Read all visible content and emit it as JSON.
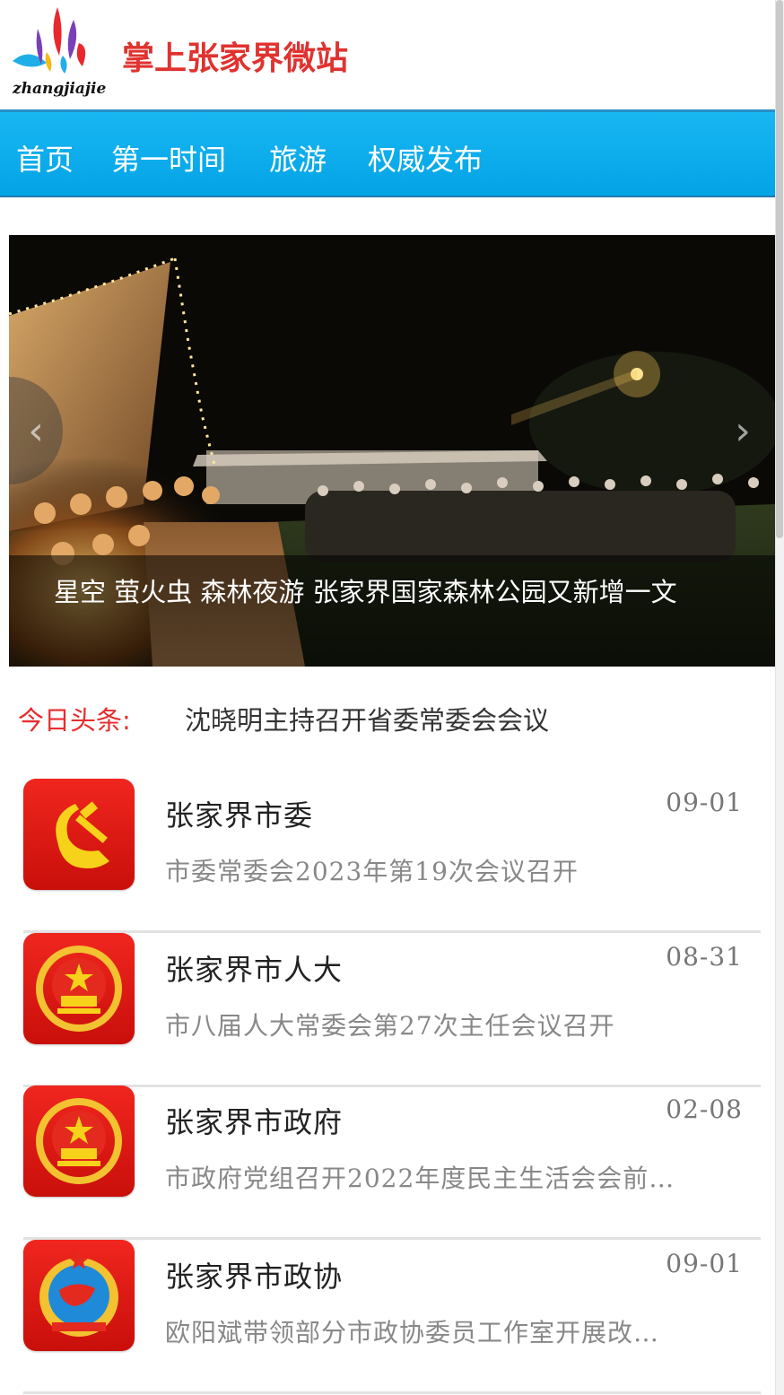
{
  "header": {
    "logo_text": "zhangjiajie",
    "site_title": "掌上张家界微站"
  },
  "nav": {
    "items": [
      {
        "label": "首页"
      },
      {
        "label": "第一时间"
      },
      {
        "label": "旅游"
      },
      {
        "label": "权威发布"
      }
    ]
  },
  "carousel": {
    "caption": "星空 萤火虫 森林夜游 张家界国家森林公园又新增一文",
    "prev_icon": "chevron-left-icon",
    "next_icon": "chevron-right-icon"
  },
  "headline": {
    "label": "今日头条:",
    "text": "沈晓明主持召开省委常委会会议"
  },
  "list": [
    {
      "title": "张家界市委",
      "date": "09-01",
      "summary": "市委常委会2023年第19次会议召开",
      "icon": "party-emblem-icon"
    },
    {
      "title": "张家界市人大",
      "date": "08-31",
      "summary": "市八届人大常委会第27次主任会议召开",
      "icon": "national-emblem-icon"
    },
    {
      "title": "张家界市政府",
      "date": "02-08",
      "summary": "市政府党组召开2022年度民主生活会会前…",
      "icon": "national-emblem-icon"
    },
    {
      "title": "张家界市政协",
      "date": "09-01",
      "summary": "欧阳斌带领部分市政协委员工作室开展改…",
      "icon": "cppcc-emblem-icon"
    }
  ],
  "colors": {
    "nav_bg": "#0aa8ea",
    "title_red": "#e0322f",
    "headline_red": "#e62d2d"
  }
}
